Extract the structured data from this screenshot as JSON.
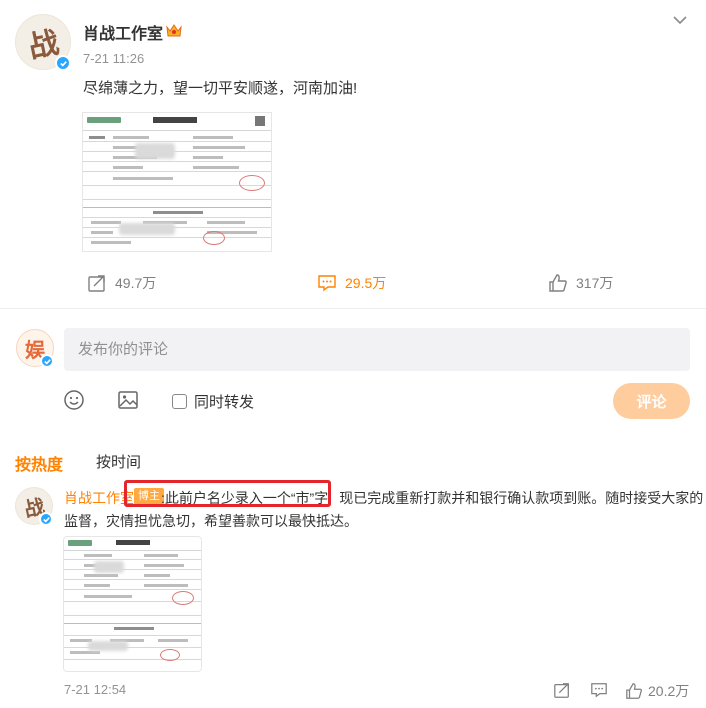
{
  "post": {
    "author": "肖战工作室",
    "avatar_glyph": "战",
    "time": "7-21 11:26",
    "text": "尽绵薄之力，望一切平安顺遂，河南加油!",
    "icons": [
      "crown-badge-icon",
      "verified-icon",
      "chevron-down-icon"
    ],
    "actions": {
      "repost": "49.7万",
      "comment": "29.5万",
      "like": "317万"
    }
  },
  "composer": {
    "avatar_glyph": "娱",
    "placeholder": "发布你的评论",
    "repost_label": "同时转发",
    "submit": "评论"
  },
  "sort": {
    "hot": "按热度",
    "time": "按时间"
  },
  "comment": {
    "author": "肖战工作室",
    "avatar_glyph": "战",
    "badge": "博主",
    "highlight_text": ":此前户名少录入一个“市”字",
    "rest_line1": "现已完成重新打款并和银行确认款项到账。随时接受大家的",
    "line2": "监督，灾情担忧急切，希望善款可以最快抵达。",
    "time": "7-21 12:54",
    "like": "20.2万"
  },
  "colors": {
    "accent": "#ff8200",
    "highlight_border": "#e4252b",
    "badge_bg": "#ffa940",
    "button_disabled": "#ffcc9e"
  }
}
